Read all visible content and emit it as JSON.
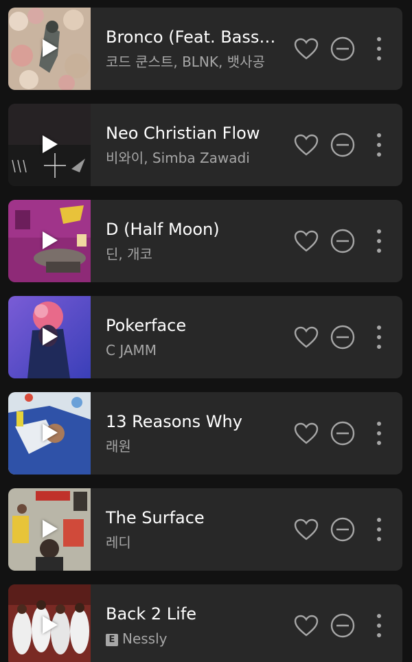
{
  "tracks": [
    {
      "title": "Bronco (Feat. Bassagong)",
      "artist": "코드 쿤스트, BLNK, 뱃사공",
      "explicit": false
    },
    {
      "title": "Neo Christian Flow",
      "artist": "비와이, Simba Zawadi",
      "explicit": false
    },
    {
      "title": "D (Half Moon)",
      "artist": "딘, 개코",
      "explicit": false
    },
    {
      "title": "Pokerface",
      "artist": "C JAMM",
      "explicit": false
    },
    {
      "title": "13 Reasons Why",
      "artist": "래원",
      "explicit": false
    },
    {
      "title": "The Surface",
      "artist": "레디",
      "explicit": false
    },
    {
      "title": "Back 2 Life",
      "artist": "Nessly",
      "explicit": true,
      "explicit_label": "E"
    }
  ],
  "colors": {
    "background": "#121212",
    "row": "#282828",
    "title": "#ffffff",
    "subtitle": "#a7a7a7",
    "icon": "#a7a7a7"
  },
  "icons": [
    "play-icon",
    "heart-icon",
    "hide-icon",
    "more-icon"
  ]
}
